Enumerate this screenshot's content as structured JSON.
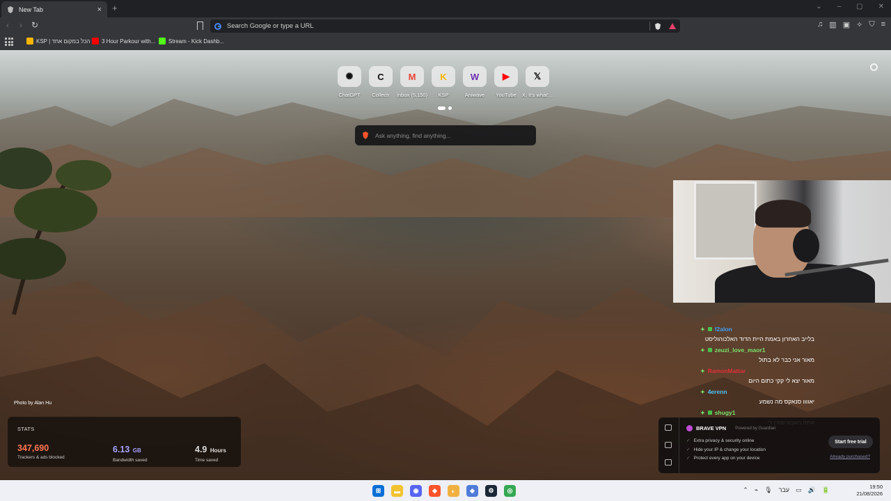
{
  "tab": {
    "title": "New Tab",
    "close": "×",
    "new": "+"
  },
  "window_controls": [
    "⌄",
    "–",
    "▢",
    "✕"
  ],
  "toolbar": {
    "back": "‹",
    "forward": "›",
    "reload": "↻",
    "omnibox_placeholder": "Search Google or type a URL",
    "right_icons": [
      "♫",
      "▥",
      "▣",
      "✧",
      "⛉",
      "≡"
    ]
  },
  "bookmarks": [
    {
      "label": "KSP | הכל במקום אחד",
      "color": "#f7b500"
    },
    {
      "label": "3 Hour Parkour with...",
      "color": "#ff0000"
    },
    {
      "label": "Stream - Kick Dashb...",
      "color": "#53fc18"
    }
  ],
  "top_sites": [
    {
      "label": "ChatGPT",
      "icon": "chatgpt-icon",
      "glyph": "✺",
      "color": "#111111"
    },
    {
      "label": "Collectr",
      "icon": "collectr-icon",
      "glyph": "C",
      "color": "#111111"
    },
    {
      "label": "Inbox (5,150)",
      "icon": "gmail-icon",
      "glyph": "M",
      "color": "#ea4335"
    },
    {
      "label": "KSP",
      "icon": "ksp-icon",
      "glyph": "K",
      "color": "#f7b500"
    },
    {
      "label": "Aniwave",
      "icon": "aniwave-icon",
      "glyph": "W",
      "color": "#6b2fb3"
    },
    {
      "label": "YouTube",
      "icon": "youtube-icon",
      "glyph": "▶",
      "color": "#ff0000"
    },
    {
      "label": "X. It's what'...",
      "icon": "x-icon",
      "glyph": "𝕏",
      "color": "#111111"
    }
  ],
  "search": {
    "placeholder": "Ask anything, find anything..."
  },
  "photo_credit": "Photo by Alan Hu",
  "stats": {
    "title": "STATS",
    "trackers": {
      "value": "347,690",
      "label": "Trackers & ads blocked",
      "color": "#ff7654"
    },
    "bandwidth": {
      "value": "6.13",
      "unit": "GB",
      "label": "Bandwidth saved",
      "color": "#a8a2ff"
    },
    "time": {
      "value": "4.9",
      "unit": "Hours",
      "label": "Time saved",
      "color": "#ffffff"
    }
  },
  "chat": [
    {
      "user": "f2alon",
      "color": "#3f9df5",
      "text": "בלייב האחרון באמת היית הדוד האלכוהוליסט"
    },
    {
      "user": "zeuzi_love_maor1",
      "color": "#7be26a",
      "text": "מאור אני כבר לא בתול"
    },
    {
      "user": "RamonMattar",
      "color": "#e0303a",
      "text": "מאור יצא לי קקי כתום היום"
    },
    {
      "user": "4erenn",
      "color": "#4fc3f7",
      "text": "יאוווו סנאקס מה נשמע"
    },
    {
      "user": "shugy1",
      "color": "#7be26a",
      "text": "אתה האבא שאין לי"
    }
  ],
  "vpn": {
    "title": "BRAVE VPN",
    "powered": "Powered by Guardian",
    "features": [
      "Extra privacy & security online",
      "Hide your IP & change your location",
      "Protect every app on your device"
    ],
    "cta": "Start free trial",
    "link": "Already purchased?"
  },
  "taskbar": {
    "apps": [
      {
        "name": "windows-start-icon",
        "glyph": "⊞",
        "color": "#0a6fd6"
      },
      {
        "name": "file-explorer-icon",
        "glyph": "▬",
        "color": "#f2c230"
      },
      {
        "name": "discord-icon",
        "glyph": "◉",
        "color": "#5865f2"
      },
      {
        "name": "brave-icon",
        "glyph": "◆",
        "color": "#fb542b"
      },
      {
        "name": "obs-icon",
        "glyph": "◐",
        "color": "#f0b040"
      },
      {
        "name": "app-icon",
        "glyph": "◈",
        "color": "#4f7bd9"
      },
      {
        "name": "steam-icon",
        "glyph": "⚙",
        "color": "#1b2838"
      },
      {
        "name": "chrome-icon",
        "glyph": "◎",
        "color": "#34a853"
      }
    ],
    "tray": [
      "⌃",
      "⌁",
      "🎙",
      "עבר",
      "▭",
      "🔊",
      "🔋"
    ],
    "time": "19:50",
    "date": "21/08/2026"
  }
}
